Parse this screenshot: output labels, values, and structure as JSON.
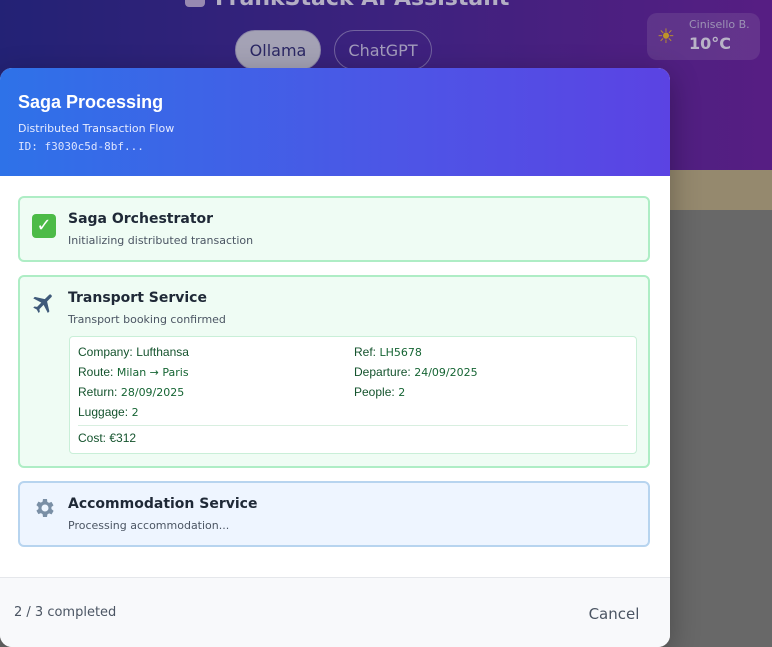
{
  "app": {
    "title": "FrankStack AI Assistant",
    "model_buttons": [
      "Ollama",
      "ChatGPT"
    ],
    "weather": {
      "icon": "sun-icon",
      "city": "Cinisello B.",
      "temperature": "10°C"
    }
  },
  "modal": {
    "title": "Saga Processing",
    "subtitle": "Distributed Transaction Flow",
    "id": "ID: f3030c5d-8bf...",
    "steps": [
      {
        "name": "Saga Orchestrator",
        "status": "Initializing distributed transaction",
        "icon": "check-icon",
        "state": "done"
      },
      {
        "name": "Transport Service",
        "status": "Transport booking confirmed",
        "icon": "airplane-icon",
        "state": "done",
        "details": {
          "company_label": "Company:",
          "company": "Lufthansa",
          "ref_label": "Ref:",
          "ref": "LH5678",
          "route_label": "Route:",
          "route": "Milan → Paris",
          "departure_label": "Departure:",
          "departure": "24/09/2025",
          "return_label": "Return:",
          "return": "28/09/2025",
          "people_label": "People:",
          "people": "2",
          "luggage_label": "Luggage:",
          "luggage": "2",
          "cost": "Cost: €312"
        }
      },
      {
        "name": "Accommodation Service",
        "status": "Processing accommodation...",
        "icon": "gear-icon",
        "state": "active"
      }
    ],
    "footer": {
      "progress": "2 / 3 completed",
      "cancel_label": "Cancel"
    }
  },
  "colors": {
    "header_start": "#2e72e8",
    "header_end": "#5b43e3",
    "done_bg": "#effcf4",
    "active_bg": "#eef5ff"
  }
}
